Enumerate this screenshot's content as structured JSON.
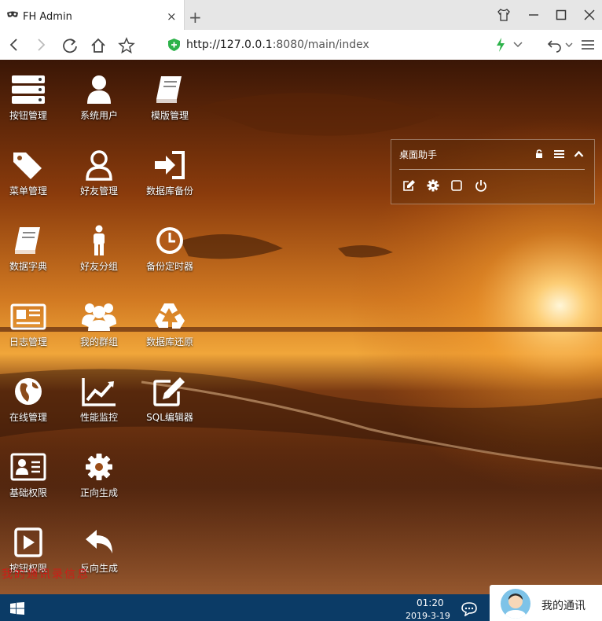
{
  "browser": {
    "tab_title": "FH Admin",
    "tab_close": "×",
    "new_tab": "+",
    "url_host": "http://127.0.0.1",
    "url_rest": ":8080/main/index"
  },
  "desktop_icons": [
    {
      "label": "按钮管理",
      "icon": "server-icon"
    },
    {
      "label": "系统用户",
      "icon": "user-icon"
    },
    {
      "label": "模版管理",
      "icon": "book-icon"
    },
    {
      "label": "菜单管理",
      "icon": "tags-icon"
    },
    {
      "label": "好友管理",
      "icon": "user-outline-icon"
    },
    {
      "label": "数据库备份",
      "icon": "sign-in-icon"
    },
    {
      "label": "数据字典",
      "icon": "book-icon"
    },
    {
      "label": "好友分组",
      "icon": "male-icon"
    },
    {
      "label": "备份定时器",
      "icon": "clock-icon"
    },
    {
      "label": "日志管理",
      "icon": "newspaper-icon"
    },
    {
      "label": "我的群组",
      "icon": "users-icon"
    },
    {
      "label": "数据库还原",
      "icon": "recycle-icon"
    },
    {
      "label": "在线管理",
      "icon": "globe-icon"
    },
    {
      "label": "性能监控",
      "icon": "line-chart-icon"
    },
    {
      "label": "SQL编辑器",
      "icon": "edit-icon"
    },
    {
      "label": "基础权限",
      "icon": "id-card-icon"
    },
    {
      "label": "正向生成",
      "icon": "gear-icon"
    },
    {
      "label": "按钮权限",
      "icon": "play-icon"
    },
    {
      "label": "反向生成",
      "icon": "reply-icon"
    }
  ],
  "widget": {
    "title": "桌面助手"
  },
  "watermark": "我的通讯录信息",
  "taskbar": {
    "time": "01:20",
    "date": "2019-3-19"
  },
  "contacts": {
    "label": "我的通讯"
  }
}
